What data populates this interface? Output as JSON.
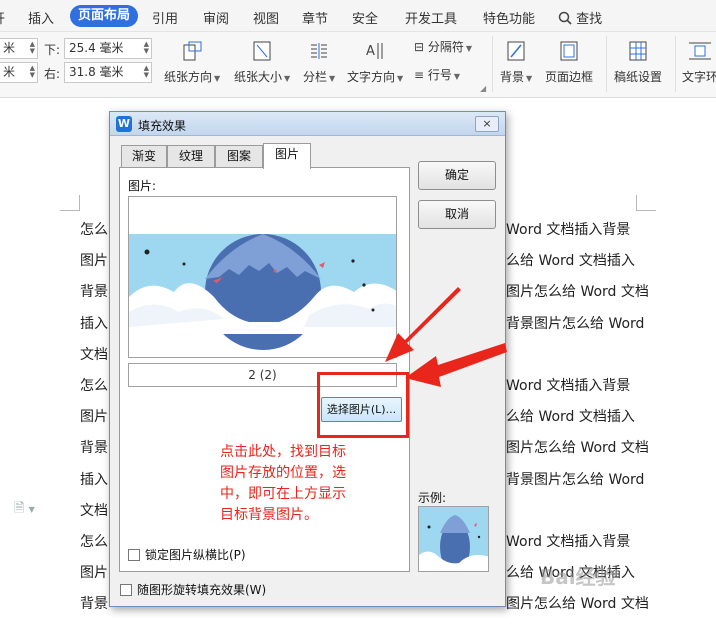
{
  "menubar": {
    "items": [
      "插入",
      "页面布局",
      "引用",
      "审阅",
      "视图",
      "章节",
      "安全",
      "开发工具",
      "特色功能"
    ],
    "active": "页面布局",
    "search_label": "查找"
  },
  "ribbon": {
    "margins": {
      "bottom_label": "下:",
      "bottom_value": "25.4 毫米",
      "right_label": "右:",
      "right_value": "31.8 毫米",
      "left_value": "米",
      "left_value2": "米"
    },
    "buttons": {
      "orientation": "纸张方向",
      "size": "纸张大小",
      "columns": "分栏",
      "text_direction": "文字方向",
      "separator": "分隔符",
      "line_number": "行号",
      "background": "背景",
      "page_border": "页面边框",
      "manuscript": "稿纸设置",
      "text_wrap": "文字环"
    }
  },
  "document": {
    "lines": [
      "Word 文档插入背景",
      "么给 Word 文档插入",
      "图片怎么给 Word 文档",
      "背景图片怎么给 Word",
      "Word 文档插入背景",
      "么给 Word 文档插入",
      "图片怎么给 Word 文档",
      "背景图片怎么给 Word",
      "Word 文档插入背景",
      "么给 Word 文档插入",
      "图片怎么给 Word 文档"
    ],
    "left_chars": [
      "怎么",
      "图片",
      "背景",
      "插入",
      "文档",
      "怎么",
      "图片",
      "背景",
      "插入",
      "文档",
      "怎么",
      "图片",
      "背景"
    ]
  },
  "dialog": {
    "title": "填充效果",
    "close": "×",
    "tabs": [
      "渐变",
      "纹理",
      "图案",
      "图片"
    ],
    "active_tab": "图片",
    "picture_label": "图片:",
    "counter": "2 (2)",
    "select_button": "选择图片(L)...",
    "lock_aspect": "锁定图片纵横比(P)",
    "rotate_with_shape": "随图形旋转填充效果(W)",
    "ok": "确定",
    "cancel": "取消",
    "sample_label": "示例:"
  },
  "annotation": {
    "text": "点击此处，找到目标\n图片存放的位置，选\n中，即可在上方显示\n目标背景图片。",
    "color": "#e8261c"
  },
  "watermark": "Bai经验",
  "colors": {
    "accent": "#2f6fe0",
    "annotation_red": "#e8261c",
    "sky": "#9ed8f0",
    "planet": "#4a6fb0"
  }
}
